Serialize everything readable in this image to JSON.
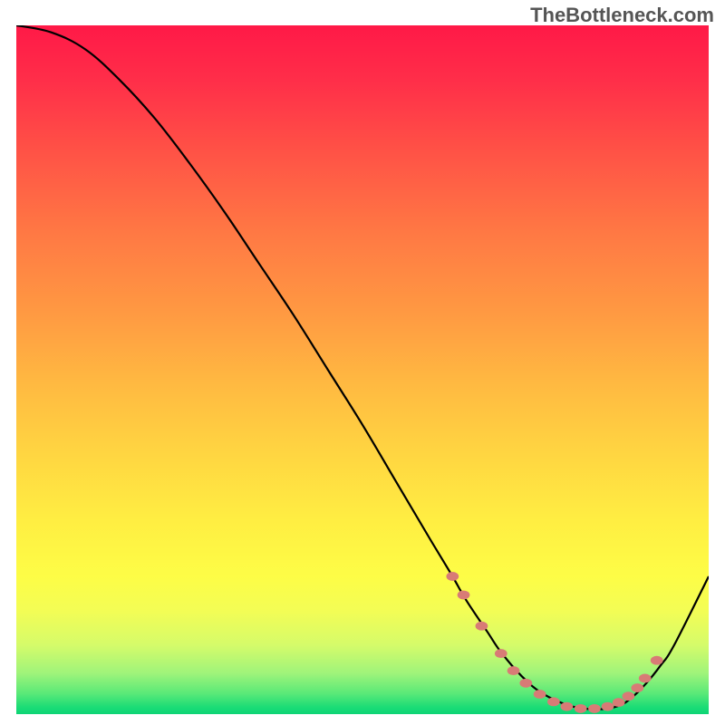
{
  "watermark": "TheBottleneck.com",
  "chart_data": {
    "type": "line",
    "title": "",
    "xlabel": "",
    "ylabel": "",
    "xlim": [
      0,
      100
    ],
    "ylim": [
      0,
      100
    ],
    "grid": false,
    "series": [
      {
        "name": "curve",
        "x": [
          0,
          5,
          10,
          15,
          20,
          25,
          30,
          35,
          40,
          45,
          50,
          55,
          60,
          63,
          65,
          68,
          70,
          73,
          76,
          80,
          84,
          87,
          89,
          91,
          93,
          95,
          100
        ],
        "y": [
          100,
          99,
          96.5,
          92,
          86.5,
          80,
          73,
          65.5,
          58,
          50,
          42,
          33.5,
          25,
          20,
          16.5,
          12,
          9,
          5.5,
          3,
          1.2,
          0.7,
          1.2,
          2.5,
          4.5,
          7,
          10,
          20
        ]
      }
    ],
    "markers": {
      "name": "points",
      "rx": 0.9,
      "ry": 0.65,
      "points": [
        {
          "x": 63.0,
          "y": 20.0
        },
        {
          "x": 64.6,
          "y": 17.3
        },
        {
          "x": 67.2,
          "y": 12.8
        },
        {
          "x": 70.0,
          "y": 8.8
        },
        {
          "x": 71.8,
          "y": 6.3
        },
        {
          "x": 73.6,
          "y": 4.5
        },
        {
          "x": 75.6,
          "y": 2.9
        },
        {
          "x": 77.6,
          "y": 1.8
        },
        {
          "x": 79.5,
          "y": 1.1
        },
        {
          "x": 81.5,
          "y": 0.8
        },
        {
          "x": 83.5,
          "y": 0.8
        },
        {
          "x": 85.4,
          "y": 1.1
        },
        {
          "x": 87.0,
          "y": 1.7
        },
        {
          "x": 88.4,
          "y": 2.6
        },
        {
          "x": 89.7,
          "y": 3.8
        },
        {
          "x": 90.8,
          "y": 5.2
        },
        {
          "x": 92.5,
          "y": 7.8
        }
      ]
    },
    "background_gradient": {
      "direction": "vertical",
      "stops": [
        {
          "pos": 0.0,
          "color": "#ff1947"
        },
        {
          "pos": 0.5,
          "color": "#ffb941"
        },
        {
          "pos": 0.82,
          "color": "#fdfd46"
        },
        {
          "pos": 1.0,
          "color": "#0dd475"
        }
      ]
    }
  }
}
